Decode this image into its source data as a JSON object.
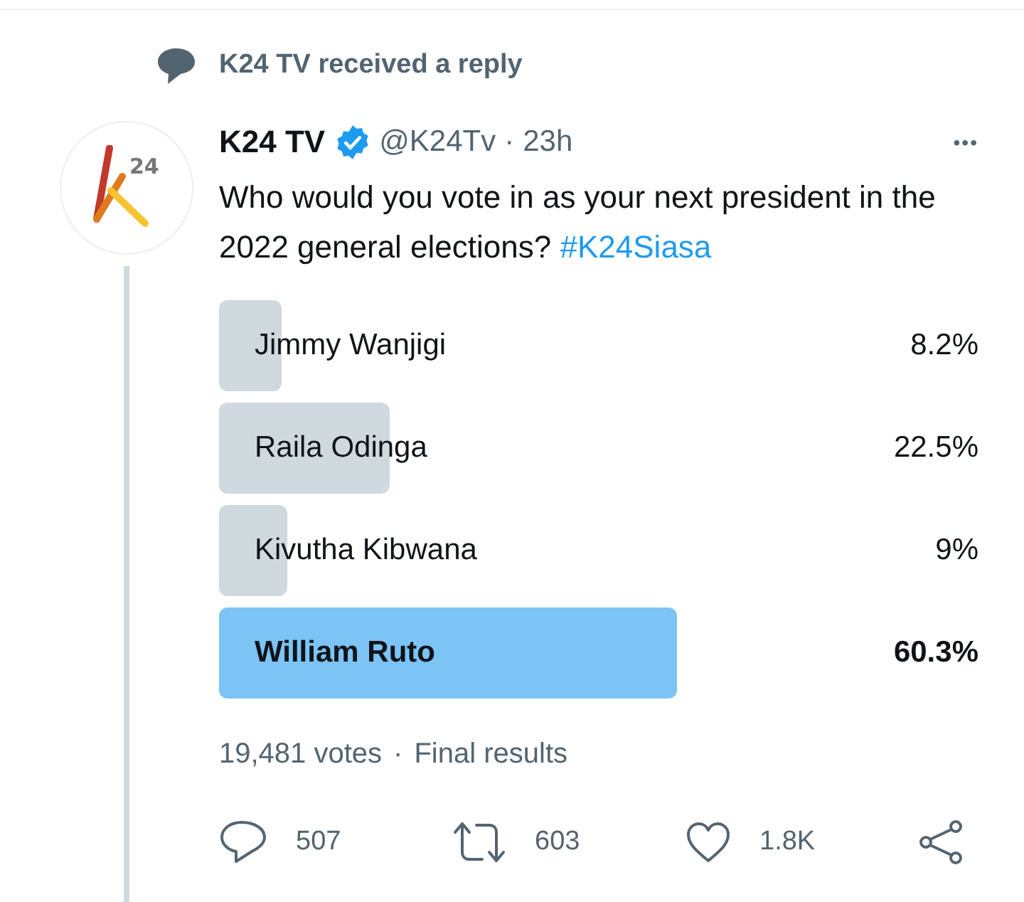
{
  "context": {
    "text": "K24 TV received a reply"
  },
  "avatar": {
    "logo_text": "24"
  },
  "tweet": {
    "name": "K24 TV",
    "verified": true,
    "handle": "@K24Tv",
    "separator": "·",
    "time": "23h",
    "more": "•••",
    "text": "Who would you vote in as your next president in the 2022 general elections?",
    "hashtag": "#K24Siasa"
  },
  "poll": {
    "options": [
      {
        "label": "Jimmy Wanjigi",
        "percent": "8.2%",
        "selected": false
      },
      {
        "label": "Raila Odinga",
        "percent": "22.5%",
        "selected": false
      },
      {
        "label": "Kivutha Kibwana",
        "percent": "9%",
        "selected": false
      },
      {
        "label": "William Ruto",
        "percent": "60.3%",
        "selected": true
      }
    ],
    "votes": "19,481 votes",
    "separator": "·",
    "status": "Final results"
  },
  "actions": [
    {
      "kind": "reply",
      "count": "507"
    },
    {
      "kind": "retweet",
      "count": "603"
    },
    {
      "kind": "like",
      "count": "1.8K"
    },
    {
      "kind": "share"
    }
  ]
}
